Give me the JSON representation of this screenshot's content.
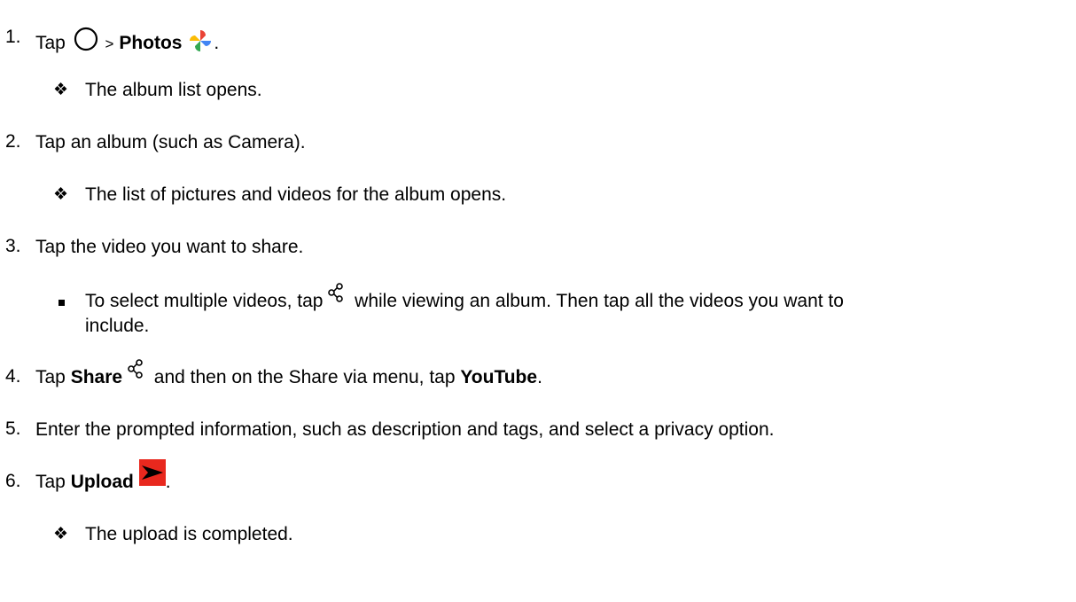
{
  "steps": [
    {
      "number": "1.",
      "tap": "Tap",
      "separator": ">",
      "target": "Photos",
      "end": ".",
      "result": "The album list opens."
    },
    {
      "number": "2.",
      "text": "Tap an album (such as Camera).",
      "result": "The list of pictures and videos for the album opens."
    },
    {
      "number": "3.",
      "text": "Tap the video you want to share.",
      "note_part1": "To select multiple videos, tap",
      "note_part2": "while viewing an album. Then tap all the videos you want to",
      "note_part3": "include."
    },
    {
      "number": "4.",
      "tap": "Tap",
      "target": "Share",
      "middle": "and then on the Share via menu, tap",
      "target2": "YouTube",
      "end": "."
    },
    {
      "number": "5.",
      "text": "Enter the prompted information, such as description and tags, and select a privacy option."
    },
    {
      "number": "6.",
      "tap": "Tap",
      "target": "Upload",
      "end": ".",
      "result": "The upload is completed."
    }
  ],
  "bullet_symbol": "❖",
  "icons": {
    "home": "home-circle-icon",
    "photos": "photos-pinwheel-icon",
    "share": "share-icon",
    "upload": "upload-send-icon"
  },
  "colors": {
    "upload_icon": "#e8281e",
    "photos_red": "#ea4335",
    "photos_yellow": "#fbbc05",
    "photos_green": "#34a853",
    "photos_blue": "#4285f4"
  }
}
